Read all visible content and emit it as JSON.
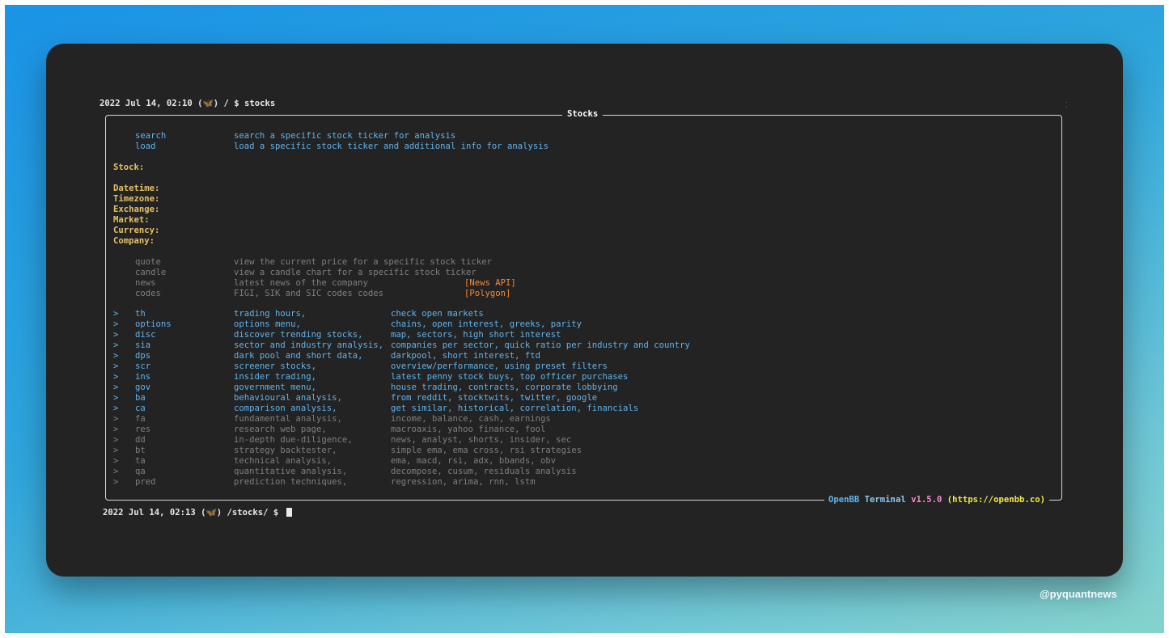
{
  "terminal": {
    "top_prompt": "2022 Jul 14, 02:10 (",
    "top_prompt_icon": "butterfly-icon",
    "top_prompt_path": ") / $ ",
    "top_prompt_cmd": "stocks",
    "bottom_prompt": "2022 Jul 14, 02:13 (",
    "bottom_prompt_path": ") /stocks/ $",
    "box_title": "Stocks",
    "footer": {
      "openbb": "OpenBB",
      "terminal": "Terminal",
      "version": "v1.5.0",
      "url": "(https://openbb.co)"
    }
  },
  "commands_top": [
    {
      "cmd": "search",
      "desc": "search a specific stock ticker for analysis"
    },
    {
      "cmd": "load",
      "desc": "load a specific stock ticker and additional info for analysis"
    }
  ],
  "stock_fields": {
    "stock": "Stock:",
    "datetime": "Datetime:",
    "timezone": "Timezone:",
    "exchange": "Exchange:",
    "market": "Market:",
    "currency": "Currency:",
    "company": "Company:"
  },
  "commands_disabled": [
    {
      "cmd": "quote",
      "desc": "view the current price for a specific stock ticker",
      "tag": ""
    },
    {
      "cmd": "candle",
      "desc": "view a candle chart for a specific stock ticker",
      "tag": ""
    },
    {
      "cmd": "news",
      "desc": "latest news of the company",
      "tag": "[News API]"
    },
    {
      "cmd": "codes",
      "desc": "FIGI, SIK and SIC codes codes",
      "tag": "[Polygon]"
    }
  ],
  "menus": [
    {
      "arrow": ">",
      "cmd": "th",
      "desc": "trading hours,",
      "detail": "check open markets",
      "enabled": true
    },
    {
      "arrow": ">",
      "cmd": "options",
      "desc": "options menu,",
      "detail": "chains, open interest, greeks, parity",
      "enabled": true
    },
    {
      "arrow": ">",
      "cmd": "disc",
      "desc": "discover trending stocks,",
      "detail": "map, sectors, high short interest",
      "enabled": true
    },
    {
      "arrow": ">",
      "cmd": "sia",
      "desc": "sector and industry analysis,",
      "detail": "companies per sector, quick ratio per industry and country",
      "enabled": true
    },
    {
      "arrow": ">",
      "cmd": "dps",
      "desc": "dark pool and short data,",
      "detail": "darkpool, short interest, ftd",
      "enabled": true
    },
    {
      "arrow": ">",
      "cmd": "scr",
      "desc": "screener stocks,",
      "detail": "overview/performance, using preset filters",
      "enabled": true
    },
    {
      "arrow": ">",
      "cmd": "ins",
      "desc": "insider trading,",
      "detail": "latest penny stock buys, top officer purchases",
      "enabled": true
    },
    {
      "arrow": ">",
      "cmd": "gov",
      "desc": "government menu,",
      "detail": "house trading, contracts, corporate lobbying",
      "enabled": true
    },
    {
      "arrow": ">",
      "cmd": "ba",
      "desc": "behavioural analysis,",
      "detail": "from reddit, stocktwits, twitter, google",
      "enabled": true
    },
    {
      "arrow": ">",
      "cmd": "ca",
      "desc": "comparison analysis,",
      "detail": "get similar, historical, correlation, financials",
      "enabled": true
    },
    {
      "arrow": ">",
      "cmd": "fa",
      "desc": "fundamental analysis,",
      "detail": "income, balance, cash, earnings",
      "enabled": false
    },
    {
      "arrow": ">",
      "cmd": "res",
      "desc": "research web page,",
      "detail": "macroaxis, yahoo finance, fool",
      "enabled": false
    },
    {
      "arrow": ">",
      "cmd": "dd",
      "desc": "in-depth due-diligence,",
      "detail": "news, analyst, shorts, insider, sec",
      "enabled": false
    },
    {
      "arrow": ">",
      "cmd": "bt",
      "desc": "strategy backtester,",
      "detail": "simple ema, ema cross, rsi strategies",
      "enabled": false
    },
    {
      "arrow": ">",
      "cmd": "ta",
      "desc": "technical analysis,",
      "detail": "ema, macd, rsi, adx, bbands, obv",
      "enabled": false
    },
    {
      "arrow": ">",
      "cmd": "qa",
      "desc": "quantitative analysis,",
      "detail": "decompose, cusum, residuals analysis",
      "enabled": false
    },
    {
      "arrow": ">",
      "cmd": "pred",
      "desc": "prediction techniques,",
      "detail": "regression, arima, rnn, lstm",
      "enabled": false
    }
  ],
  "watermark": "@pyquantnews"
}
